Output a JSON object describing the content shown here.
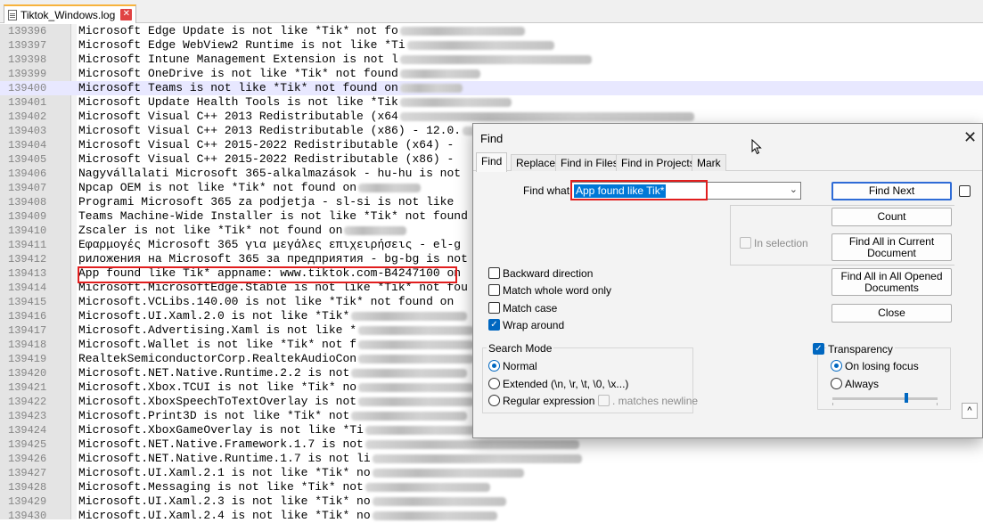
{
  "tab": {
    "title": "Tiktok_Windows.log",
    "close_symbol": "✕"
  },
  "editor": {
    "current_line_index": 4,
    "lines": [
      {
        "n": "139396",
        "t": "Microsoft Edge Update is not like *Tik* not fo",
        "b": 140
      },
      {
        "n": "139397",
        "t": "Microsoft Edge WebView2 Runtime is not like *Ti",
        "b": 165
      },
      {
        "n": "139398",
        "t": "Microsoft Intune Management Extension is not l",
        "b": 215
      },
      {
        "n": "139399",
        "t": "Microsoft OneDrive is not like *Tik* not found",
        "b": 90
      },
      {
        "n": "139400",
        "t": "Microsoft Teams is not like *Tik* not found on",
        "b": 70
      },
      {
        "n": "139401",
        "t": "Microsoft Update Health Tools is not like *Tik",
        "b": 125
      },
      {
        "n": "139402",
        "t": "Microsoft Visual C++ 2013 Redistributable (x64",
        "b": 330
      },
      {
        "n": "139403",
        "t": "Microsoft Visual C++ 2013 Redistributable (x86) - 12.0.",
        "b": 240
      },
      {
        "n": "139404",
        "t": "Microsoft Visual C++ 2015-2022 Redistributable (x64) - ",
        "b": 0
      },
      {
        "n": "139405",
        "t": "Microsoft Visual C++ 2015-2022 Redistributable (x86) - ",
        "b": 0
      },
      {
        "n": "139406",
        "t": "Nagyvállalati Microsoft 365-alkalmazások - hu-hu is not",
        "b": 0
      },
      {
        "n": "139407",
        "t": "Npcap OEM is not like *Tik* not found on",
        "b": 70
      },
      {
        "n": "139408",
        "t": "Programi Microsoft 365 za podjetja - sl-si is not like",
        "b": 0
      },
      {
        "n": "139409",
        "t": "Teams Machine-Wide Installer is not like *Tik* not found",
        "b": 0
      },
      {
        "n": "139410",
        "t": "Zscaler is not like *Tik* not found on",
        "b": 70
      },
      {
        "n": "139411",
        "t": "Εφαρμογές Microsoft 365 για μεγάλες επιχειρήσεις - el-g",
        "b": 0
      },
      {
        "n": "139412",
        "t": "риложения на Microsoft 365 за предприятия - bg-bg is not",
        "b": 0
      },
      {
        "n": "139413",
        "t": "App found like Tik* appname: www.tiktok.com-B4247100 on",
        "b": 0
      },
      {
        "n": "139414",
        "t": "Microsoft.MicrosoftEdge.Stable is not like *Tik* not fou",
        "b": 0
      },
      {
        "n": "139415",
        "t": "Microsoft.VCLibs.140.00 is not like *Tik* not found on ",
        "b": 0
      },
      {
        "n": "139416",
        "t": "Microsoft.UI.Xaml.2.0 is not like *Tik*",
        "b": 130
      },
      {
        "n": "139417",
        "t": "Microsoft.Advertising.Xaml is not like *",
        "b": 130
      },
      {
        "n": "139418",
        "t": "Microsoft.Wallet is not like *Tik* not f",
        "b": 130
      },
      {
        "n": "139419",
        "t": "RealtekSemiconductorCorp.RealtekAudioCon",
        "b": 130
      },
      {
        "n": "139420",
        "t": "Microsoft.NET.Native.Runtime.2.2 is not",
        "b": 130
      },
      {
        "n": "139421",
        "t": "Microsoft.Xbox.TCUI is not like *Tik* no",
        "b": 130
      },
      {
        "n": "139422",
        "t": "Microsoft.XboxSpeechToTextOverlay is not",
        "b": 130
      },
      {
        "n": "139423",
        "t": "Microsoft.Print3D is not like *Tik* not",
        "b": 130
      },
      {
        "n": "139424",
        "t": "Microsoft.XboxGameOverlay is not like *Ti",
        "b": 130
      },
      {
        "n": "139425",
        "t": "Microsoft.NET.Native.Framework.1.7 is not",
        "b": 240
      },
      {
        "n": "139426",
        "t": "Microsoft.NET.Native.Runtime.1.7 is not li",
        "b": 235
      },
      {
        "n": "139427",
        "t": "Microsoft.UI.Xaml.2.1 is not like *Tik* no",
        "b": 170
      },
      {
        "n": "139428",
        "t": "Microsoft.Messaging is not like *Tik* not",
        "b": 140
      },
      {
        "n": "139429",
        "t": "Microsoft.UI.Xaml.2.3 is not like *Tik* no",
        "b": 150
      },
      {
        "n": "139430",
        "t": "Microsoft.UI.Xaml.2.4 is not like *Tik* no",
        "b": 140
      }
    ]
  },
  "find_dialog": {
    "title": "Find",
    "close_symbol": "✕",
    "tabs": [
      "Find",
      "Replace",
      "Find in Files",
      "Find in Projects",
      "Mark"
    ],
    "find_what_label": "Find what",
    "find_what_value": "App found like Tik*",
    "buttons": {
      "find_next": "Find Next",
      "count": "Count",
      "find_all_current": "Find All in Current Document",
      "find_all_opened": "Find All in All Opened Documents",
      "close": "Close",
      "collapse": "^"
    },
    "in_selection": "In selection",
    "options": {
      "backward": "Backward direction",
      "whole_word": "Match whole word only",
      "match_case": "Match case",
      "wrap_around": "Wrap around"
    },
    "search_mode": {
      "title": "Search Mode",
      "normal": "Normal",
      "extended": "Extended (\\n, \\r, \\t, \\0, \\x...)",
      "regex": "Regular expression",
      "matches_newline": ". matches newline"
    },
    "transparency": {
      "title": "Transparency",
      "on_losing_focus": "On losing focus",
      "always": "Always",
      "level": 0.7
    },
    "checkmark": "✓"
  }
}
